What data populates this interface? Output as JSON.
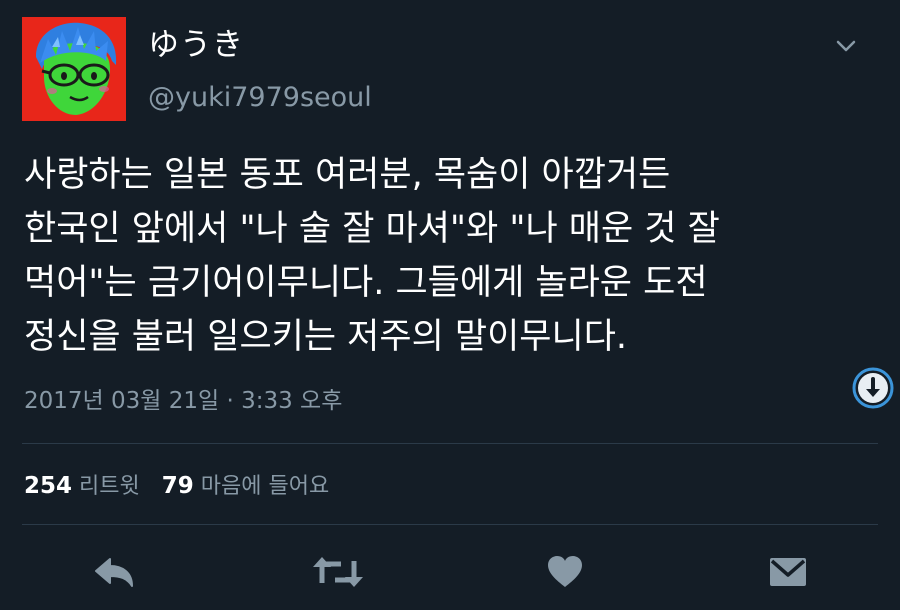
{
  "user": {
    "display_name": "ゆうき",
    "handle": "@yuki7979seoul"
  },
  "tweet": {
    "lines": [
      "사랑하는 일본 동포 여러분, 목숨이 아깝거든",
      "한국인 앞에서 \"나 술 잘 마셔\"와 \"나 매운 것 잘",
      "먹어\"는 금기어이무니다. 그들에게 놀라운 도전",
      "정신을 불러 일으키는 저주의 말이무니다."
    ],
    "timestamp": "2017년 03월 21일 · 3:33 오후"
  },
  "stats": {
    "retweets_count": "254",
    "retweets_label": "리트윗",
    "likes_count": "79",
    "likes_label": "마음에 들어요"
  },
  "icons": {
    "caret": "chevron-down-icon",
    "scroll": "scroll-down-icon",
    "reply": "reply-icon",
    "retweet": "retweet-icon",
    "like": "heart-icon",
    "dm": "envelope-icon"
  },
  "colors": {
    "background": "#141d26",
    "secondary_text": "#8899a6",
    "icon": "#8899a6",
    "avatar_bg": "#e8261a",
    "accent": "#1da1f2"
  }
}
